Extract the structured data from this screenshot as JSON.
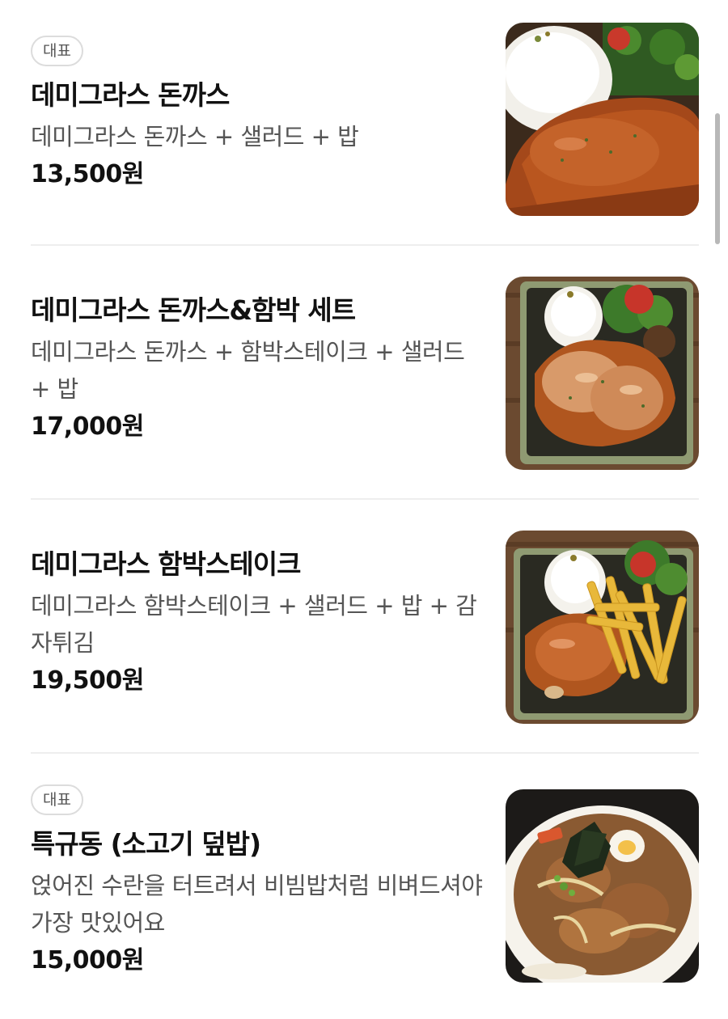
{
  "menu": {
    "items": [
      {
        "badge": "대표",
        "name": "데미그라스 돈까스",
        "description": "데미그라스 돈까스 + 샐러드 + 밥",
        "price": "13,500원",
        "photo": "demi-glace-tonkatsu-photo"
      },
      {
        "badge": "",
        "name": "데미그라스 돈까스&함박 세트",
        "description": "데미그라스 돈까스 + 함박스테이크 + 샐러드 + 밥",
        "price": "17,000원",
        "photo": "tonkatsu-hamburg-set-photo"
      },
      {
        "badge": "",
        "name": "데미그라스 함박스테이크",
        "description": "데미그라스 함박스테이크 + 샐러드 + 밥 + 감자튀김",
        "price": "19,500원",
        "photo": "hamburg-steak-fries-photo"
      },
      {
        "badge": "대표",
        "name": "특규동 (소고기 덮밥)",
        "description": "얹어진 수란을 터트려서 비빔밥처럼 비벼드셔야 가장 맛있어요",
        "price": "15,000원",
        "photo": "gyudon-beef-bowl-photo"
      }
    ]
  },
  "colors": {
    "text_primary": "#111111",
    "text_secondary": "#555555",
    "badge_border": "#dcdcdc",
    "divider": "#eeeeee",
    "scrollbar": "#b8b8b8"
  }
}
